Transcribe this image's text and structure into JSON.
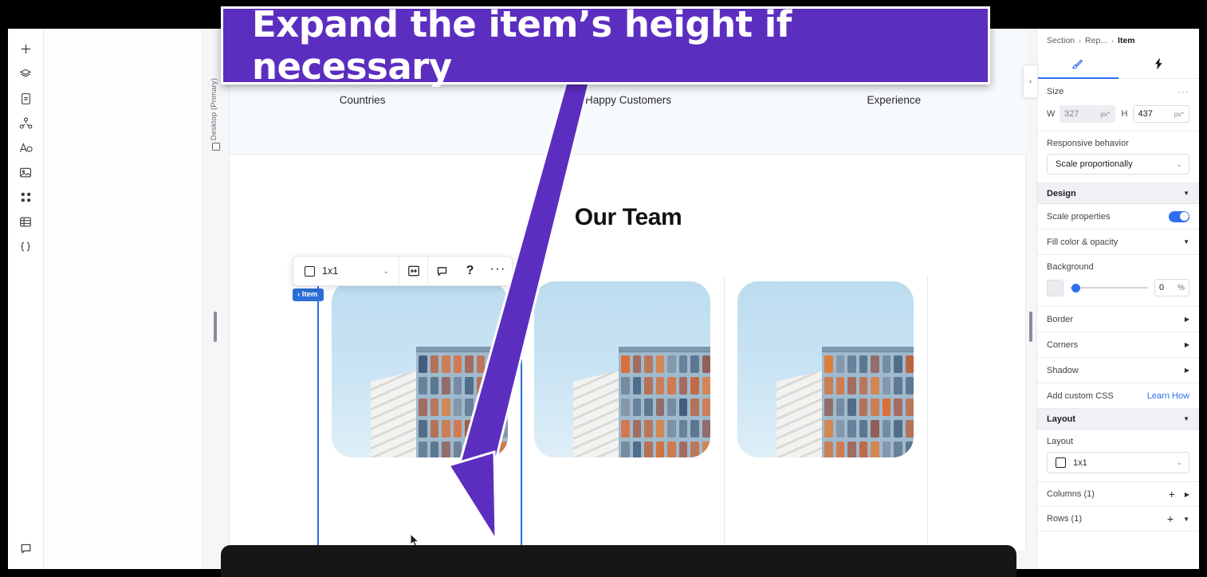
{
  "callout": {
    "text": "Expand the item’s height if necessary",
    "bg_color": "#5B2EC0",
    "text_color": "#FFFFFF"
  },
  "left_rail": {
    "items": [
      {
        "name": "add-icon",
        "label": "Add"
      },
      {
        "name": "layers-icon",
        "label": "Layers"
      },
      {
        "name": "pages-icon",
        "label": "Pages"
      },
      {
        "name": "site-structure-icon",
        "label": "Site structure"
      },
      {
        "name": "text-icon",
        "label": "Text"
      },
      {
        "name": "media-icon",
        "label": "Media"
      },
      {
        "name": "apps-icon",
        "label": "Apps"
      },
      {
        "name": "cms-icon",
        "label": "CMS"
      },
      {
        "name": "dev-mode-icon",
        "label": "Dev mode"
      }
    ],
    "bottom_item": {
      "name": "comments-icon",
      "label": "Comments"
    }
  },
  "canvas": {
    "viewport_label": "Desktop (Primary)",
    "zoom_handle_left": "resize-handle-left",
    "zoom_handle_right": "resize-handle-right",
    "collapse_label": "›"
  },
  "site": {
    "stats": [
      {
        "label": "Countries"
      },
      {
        "label": "Happy Customers"
      },
      {
        "label": "Experience"
      }
    ],
    "section_title": "Our Team",
    "cards": [
      {
        "name": "team-card-1",
        "selected": true
      },
      {
        "name": "team-card-2",
        "selected": false
      },
      {
        "name": "team-card-3",
        "selected": false
      }
    ],
    "selection_badge": "‹ Item"
  },
  "float_toolbar": {
    "layout_value": "1x1",
    "caret": "⌄",
    "buttons": [
      {
        "name": "stretch-icon",
        "label": "Stretch"
      },
      {
        "name": "comment-icon",
        "label": "Comment"
      },
      {
        "name": "help-icon",
        "label": "?"
      },
      {
        "name": "more-options-icon",
        "label": "···"
      }
    ]
  },
  "inspector": {
    "breadcrumb": {
      "items": [
        "Section",
        "Rep...",
        "Item"
      ],
      "separator": "›"
    },
    "tabs": [
      {
        "name": "design-tab",
        "icon": "brush-icon",
        "active": true
      },
      {
        "name": "interactions-tab",
        "icon": "lightning-icon",
        "active": false
      }
    ],
    "size": {
      "title": "Size",
      "more": "···",
      "w_label": "W",
      "w_value": "327",
      "w_unit": "px*",
      "h_label": "H",
      "h_value": "437",
      "h_unit": "px*"
    },
    "responsive": {
      "label": "Responsive behavior",
      "value": "Scale proportionally",
      "caret": "⌄"
    },
    "design": {
      "title": "Design",
      "caret": "▼",
      "scale_properties": {
        "label": "Scale properties",
        "enabled": true
      },
      "fill": {
        "label": "Fill color & opacity",
        "caret": "▼",
        "background_label": "Background",
        "opacity_value": "0",
        "opacity_unit": "%"
      },
      "rows": [
        {
          "label": "Border",
          "caret": "▶"
        },
        {
          "label": "Corners",
          "caret": "▶"
        },
        {
          "label": "Shadow",
          "caret": "▶"
        }
      ],
      "custom_css": {
        "label": "Add custom CSS",
        "link": "Learn How"
      }
    },
    "layout": {
      "title": "Layout",
      "caret": "▼",
      "field_label": "Layout",
      "value": "1x1",
      "caret_small": "⌄",
      "columns": {
        "label": "Columns (1)",
        "plus": "+",
        "caret": "▶"
      },
      "rows": {
        "label": "Rows (1)",
        "plus": "+",
        "caret": "▼"
      }
    }
  },
  "colors": {
    "accent_blue": "#2F6FED",
    "selection_blue": "#2B6FD6",
    "callout_purple": "#5B2EC0",
    "panel_bg": "#FFFFFF",
    "canvas_bg": "#F6F6F8"
  }
}
